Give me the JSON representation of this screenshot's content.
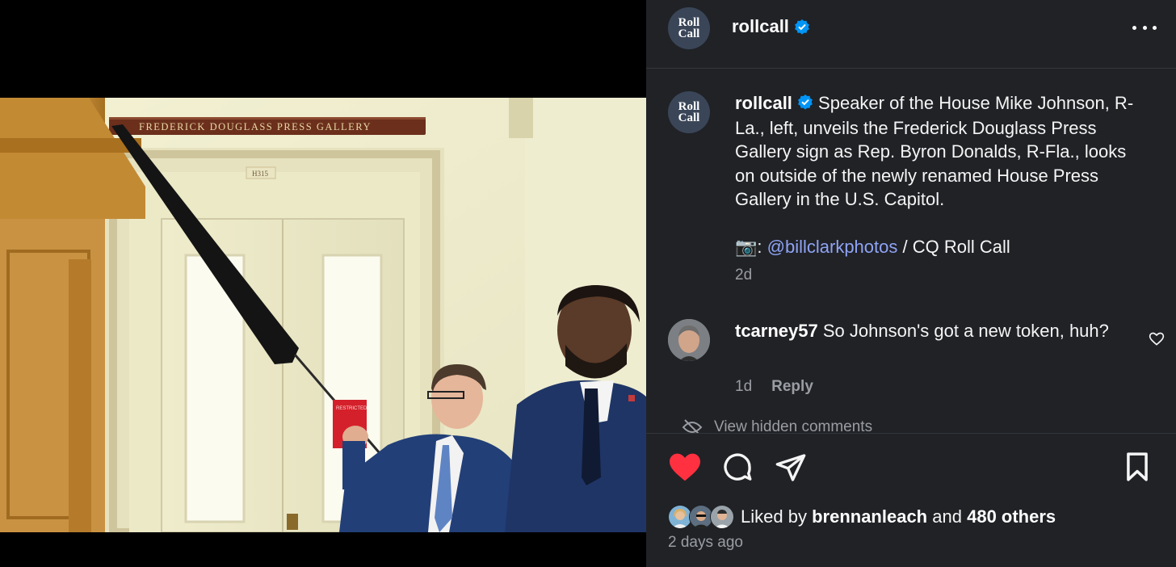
{
  "post": {
    "username": "rollcall",
    "avatar_text_line1": "Roll",
    "avatar_text_line2": "Call",
    "caption_text": "Speaker of the House Mike Johnson, R-La., left, unveils the Frederick Douglass Press Gallery sign as Rep. Byron Donalds, R-Fla., looks on outside of the newly renamed House Press Gallery in the U.S. Capitol.",
    "credit_emoji": "📷:",
    "credit_mention": "@billclarkphotos",
    "credit_suffix": "/ CQ Roll Call",
    "caption_age": "2d"
  },
  "photo": {
    "sign_text": "FREDERICK DOUGLASS PRESS GALLERY",
    "room_number": "H315",
    "card_text": "RESTRICTED"
  },
  "comment": {
    "username": "tcarney57",
    "text": "So Johnson's got a new token, huh?",
    "age": "1d",
    "reply_label": "Reply"
  },
  "hidden_comments_label": "View hidden comments",
  "likes": {
    "prefix": "Liked by",
    "first_liker": "brennanleach",
    "joiner": "and",
    "others": "480 others",
    "liked": true
  },
  "post_date": "2 days ago",
  "colors": {
    "panel_bg": "#202226",
    "like_red": "#ff3040",
    "verified_blue": "#0095f6",
    "mention_blue": "#8fa3f5"
  },
  "icons": [
    "more-icon",
    "verified-badge-icon",
    "heart-icon",
    "comment-bubble-icon",
    "share-paper-plane-icon",
    "bookmark-icon",
    "hidden-eye-icon"
  ]
}
